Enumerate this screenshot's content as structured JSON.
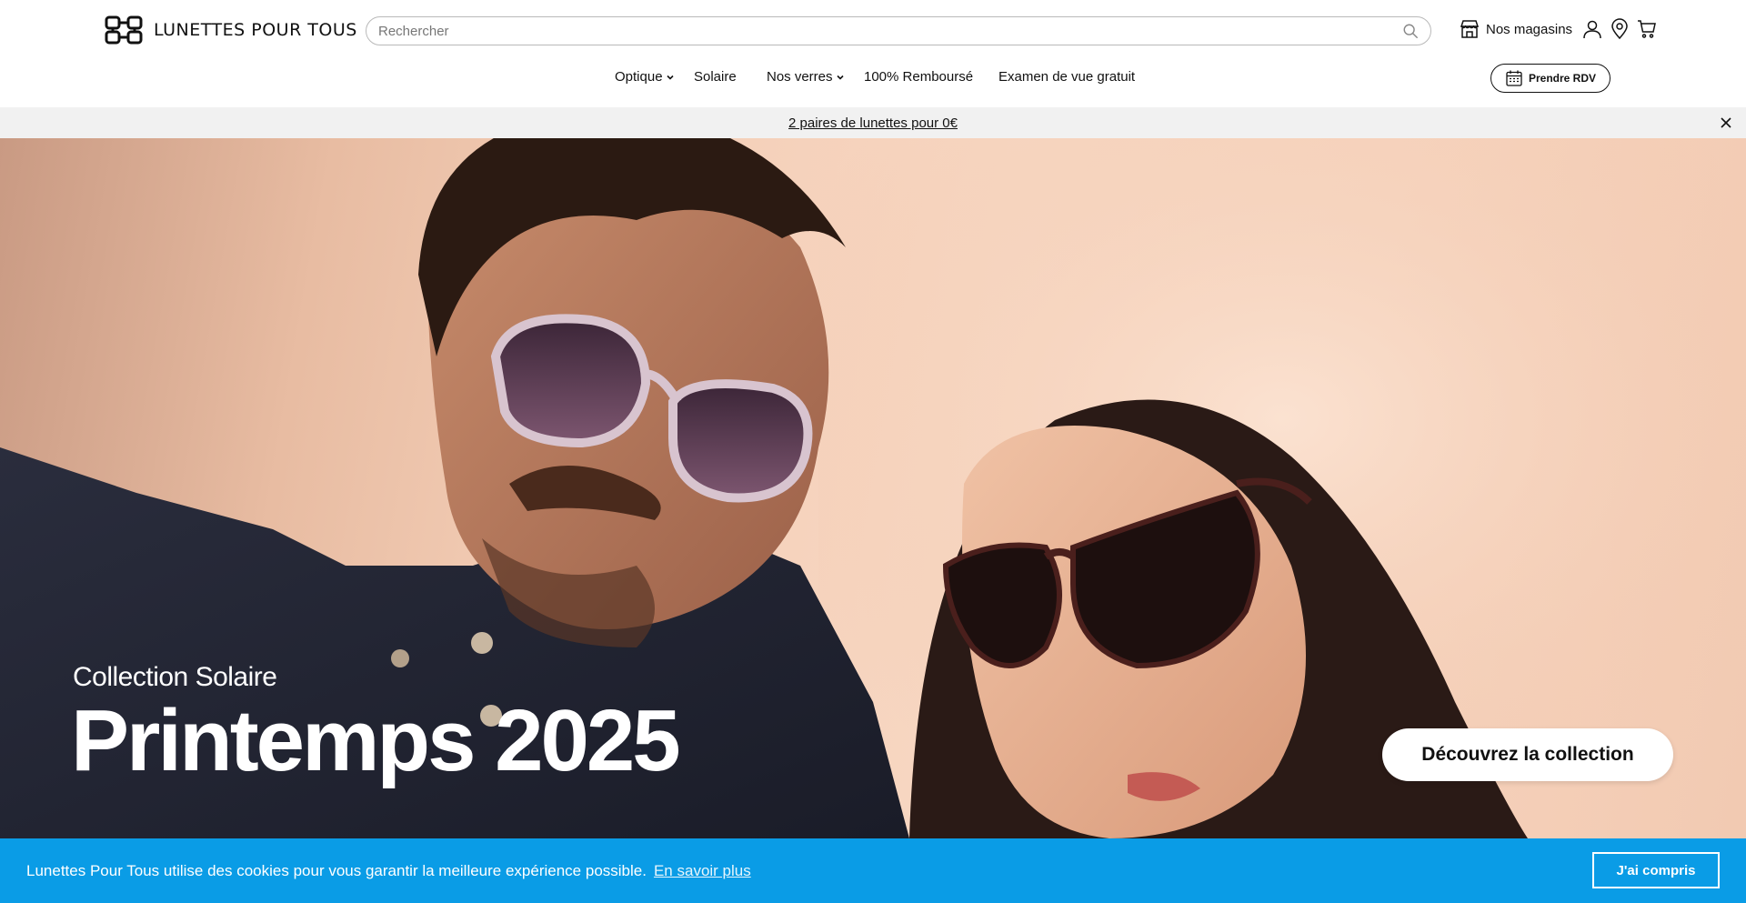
{
  "brand": {
    "name": "LUNETTES POUR TOUS"
  },
  "search": {
    "placeholder": "Rechercher"
  },
  "header": {
    "stores_label": "Nos magasins",
    "icons": [
      "store-icon",
      "user-icon",
      "location-pin-icon",
      "cart-icon"
    ]
  },
  "nav": {
    "items": [
      {
        "label": "Optique",
        "has_dropdown": true
      },
      {
        "label": "Solaire",
        "has_dropdown": false
      },
      {
        "label": "Nos verres",
        "has_dropdown": true
      },
      {
        "label": "100% Remboursé",
        "has_dropdown": false
      },
      {
        "label": "Examen de vue gratuit",
        "has_dropdown": false
      }
    ],
    "rdv_label": "Prendre RDV"
  },
  "promo": {
    "text": "2 paires de lunettes pour 0€"
  },
  "hero": {
    "subtitle": "Collection Solaire",
    "title": "Printemps 2025",
    "cta_label": "Découvrez la collection"
  },
  "cookie": {
    "message": "Lunettes Pour Tous utilise des cookies pour vous garantir la meilleure expérience possible.",
    "link_label": "En savoir plus",
    "accept_label": "J'ai compris"
  },
  "colors": {
    "cookie_bar": "#0a9ce6",
    "promo_bar": "#f1f1f1",
    "hero_bg": "#f6d3bd"
  }
}
